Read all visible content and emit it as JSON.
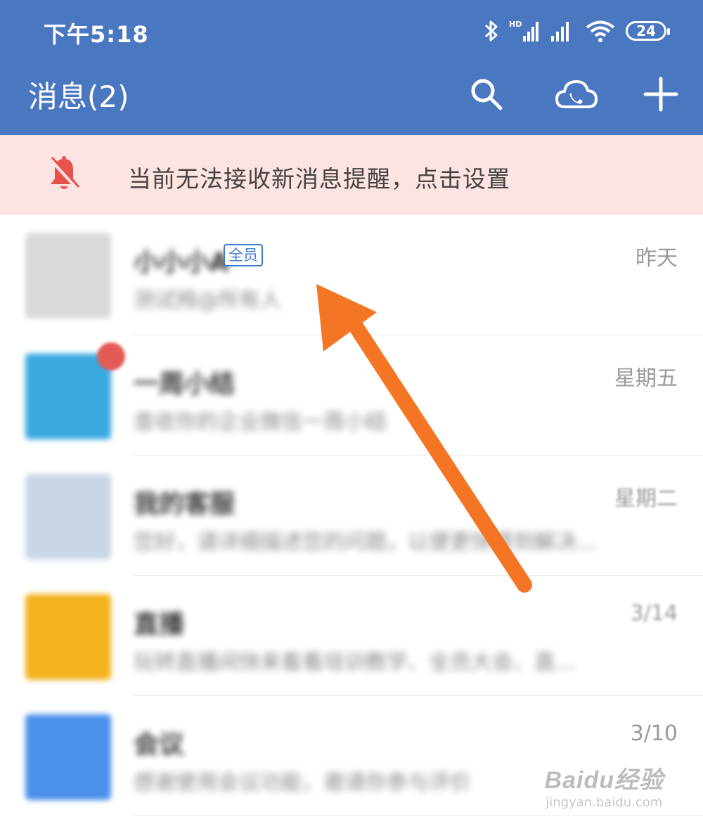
{
  "status_bar": {
    "time": "下午5:18",
    "battery": "24",
    "signal_label": "HD"
  },
  "header": {
    "title": "消息(2)"
  },
  "banner": {
    "text": "当前无法接收新消息提醒，点击设置"
  },
  "conversations": [
    {
      "title": "小小小A",
      "tag": "全员",
      "preview": "测试拇@所有人",
      "time": "昨天",
      "avatar_color": "#d9d9d9"
    },
    {
      "title": "一周小结",
      "preview": "查收你的企业微信一周小结",
      "time": "星期五",
      "avatar_color": "#3aa9e0",
      "badge": true
    },
    {
      "title": "我的客服",
      "preview": "您好，请详细描述您的问题，以便更快得到解决...",
      "time": "星期二",
      "avatar_color": "#c9d6e6"
    },
    {
      "title": "直播",
      "preview": "玩转直播间快来看看培训教学、全员大会、直...",
      "time": "3/14",
      "avatar_color": "#f3b21d"
    },
    {
      "title": "会议",
      "preview": "感谢使用会议功能，邀请你参与评价",
      "time": "3/10",
      "avatar_color": "#4a90ec"
    }
  ],
  "watermark": {
    "logo": "Baidu经验",
    "url": "jingyan.baidu.com"
  },
  "colors": {
    "header": "#4a78c0",
    "banner": "#fde3e2",
    "arrow": "#f47523",
    "bell": "#e8524d"
  }
}
